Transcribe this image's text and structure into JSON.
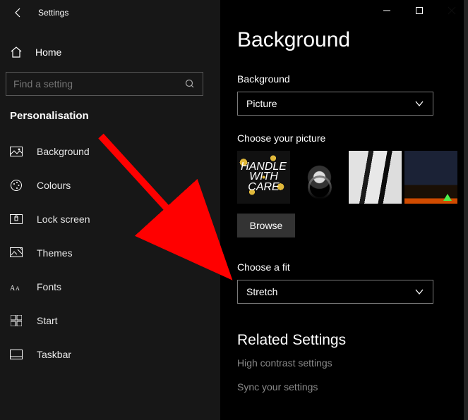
{
  "window": {
    "title": "Settings"
  },
  "home_label": "Home",
  "search": {
    "placeholder": "Find a setting"
  },
  "section": "Personalisation",
  "sidebar": {
    "items": [
      {
        "label": "Background"
      },
      {
        "label": "Colours"
      },
      {
        "label": "Lock screen"
      },
      {
        "label": "Themes"
      },
      {
        "label": "Fonts"
      },
      {
        "label": "Start"
      },
      {
        "label": "Taskbar"
      }
    ]
  },
  "page": {
    "heading": "Background",
    "bg_label": "Background",
    "bg_value": "Picture",
    "picture_label": "Choose your picture",
    "thumb1_text": "HANDLE WITH CARE",
    "browse": "Browse",
    "fit_label": "Choose a fit",
    "fit_value": "Stretch",
    "related_heading": "Related Settings",
    "related_links": [
      "High contrast settings",
      "Sync your settings"
    ]
  }
}
